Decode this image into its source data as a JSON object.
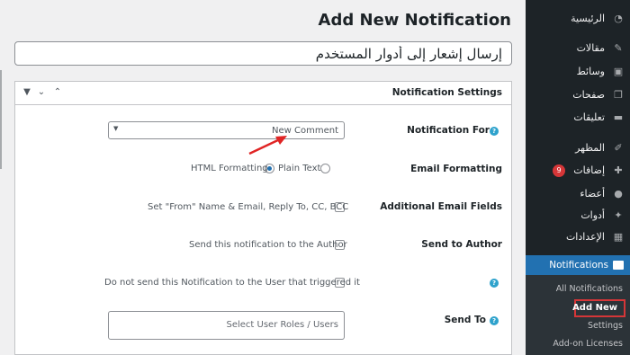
{
  "page": {
    "title": "Add New Notification",
    "title_value": "إرسال إشعار إلى أدوار المستخدم"
  },
  "panel": {
    "title": "Notification Settings",
    "controls": [
      "chevron-up-icon",
      "chevron-down-icon",
      "triangle-down-icon"
    ]
  },
  "settings": {
    "notification_for": {
      "label": "Notification For",
      "value": "New Comment"
    },
    "email_formatting": {
      "label": "Email Formatting",
      "options": [
        "HTML Formatting",
        "Plain Text"
      ],
      "selected": "HTML Formatting"
    },
    "additional_email_fields": {
      "label": "Additional Email Fields",
      "checkbox_label": "Set \"From\" Name & Email, Reply To, CC, BCC",
      "checked": false
    },
    "send_to_author": {
      "label": "Send to Author",
      "checkbox_label": "Send this notification to the Author",
      "checked": false
    },
    "do_not_send": {
      "checkbox_label": "Do not send this Notification to the User that triggered it",
      "checked": false
    },
    "send_to": {
      "label": "Send To",
      "placeholder": "Select User Roles / Users"
    }
  },
  "sidebar": {
    "items": [
      {
        "label": "الرئيسية",
        "icon": "dashboard-icon"
      },
      {
        "label": "مقالات",
        "icon": "pin-icon"
      },
      {
        "label": "وسائط",
        "icon": "media-icon"
      },
      {
        "label": "صفحات",
        "icon": "pages-icon"
      },
      {
        "label": "تعليقات",
        "icon": "comments-icon"
      },
      {
        "label": "المظهر",
        "icon": "appearance-icon"
      },
      {
        "label": "إضافات",
        "icon": "plugins-icon",
        "badge": "9"
      },
      {
        "label": "أعضاء",
        "icon": "users-icon"
      },
      {
        "label": "أدوات",
        "icon": "tools-icon"
      },
      {
        "label": "الإعدادات",
        "icon": "settings-icon"
      }
    ],
    "active": {
      "label": "Notifications",
      "icon": "mail-icon"
    },
    "submenu": [
      "All Notifications",
      "Add New",
      "Settings",
      "Add-on Licenses"
    ],
    "submenu_current": "Add New"
  },
  "colors": {
    "sidebar_bg": "#1d2327",
    "active_bg": "#2271b1",
    "highlight_border": "#d63638",
    "annotation_arrow": "#e02424",
    "help_icon": "#2ea2cc"
  }
}
